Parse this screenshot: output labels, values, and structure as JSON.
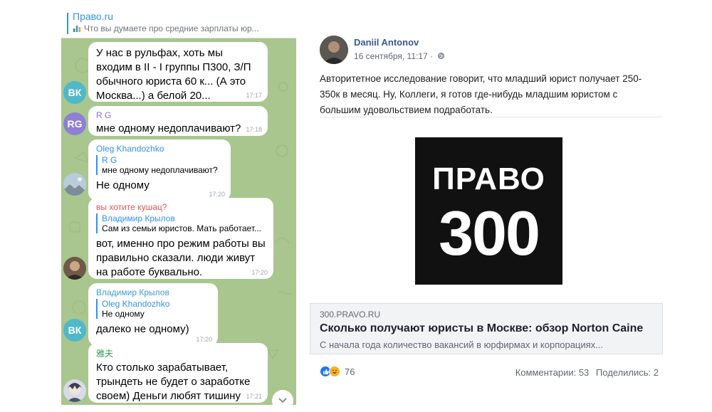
{
  "telegram": {
    "pinned": {
      "title": "Право.ru",
      "text": "Что вы думаете про средние зарплаты юр..."
    },
    "messages": [
      {
        "text": "У нас в рульфах, хоть мы входим в II - I группы П300, З/П обычного юриста 60 к... (А это Москва...) а белой 20...",
        "time": "17:17",
        "avatar": "ВК"
      },
      {
        "sender": "R G",
        "text": "мне одному недоплачивают?",
        "time": "17:18",
        "avatar": "RG"
      },
      {
        "sender": "Oleg Khandozhko",
        "reply_name": "R G",
        "reply_text": "мне одному недоплачивают?",
        "text": "Не одному",
        "time": "17:20"
      },
      {
        "sender": "вы хотите кушац?",
        "reply_name": "Владимир Крылов",
        "reply_text": "Сам из семьи юристов. Мать работает...",
        "text": "вот, именно про режим работы вы правильно сказали. люди живут на работе буквально.",
        "time": "17:20"
      },
      {
        "sender": "Владимир Крылов",
        "reply_name": "Oleg Khandozhko",
        "reply_text": "Не одному",
        "text": "далеко не одному)",
        "time": "17:20",
        "avatar": "ВК"
      },
      {
        "sender": "雅夫",
        "text": "Кто столько зарабатывает, трындеть не будет о заработке своем) Деньги любят тишину",
        "time": "17:21"
      }
    ]
  },
  "facebook": {
    "author": "Daniil Antonov",
    "date": "16 сентября, 11:17 ·",
    "text": "Авторитетное исследование говорит, что младший юрист получает 250-350к в месяц. Ну, Коллеги, я готов где-нибудь младшим юристом с большим удовольствием подработать.",
    "logo_line1": "ПРАВО",
    "logo_line2": "300",
    "link": {
      "domain": "300.PRAVO.RU",
      "title": "Сколько получают юристы в Москве: обзор Norton Caine",
      "description": "С начала года количество вакансий в юрфирмах и корпорациях..."
    },
    "reactions_count": "76",
    "comments": "Комментарии: 53",
    "shares": "Поделились: 2"
  },
  "colors": {
    "telegram_accent": "#3390ec",
    "telegram_bg": "#a6c48b",
    "facebook_link": "#385898"
  }
}
